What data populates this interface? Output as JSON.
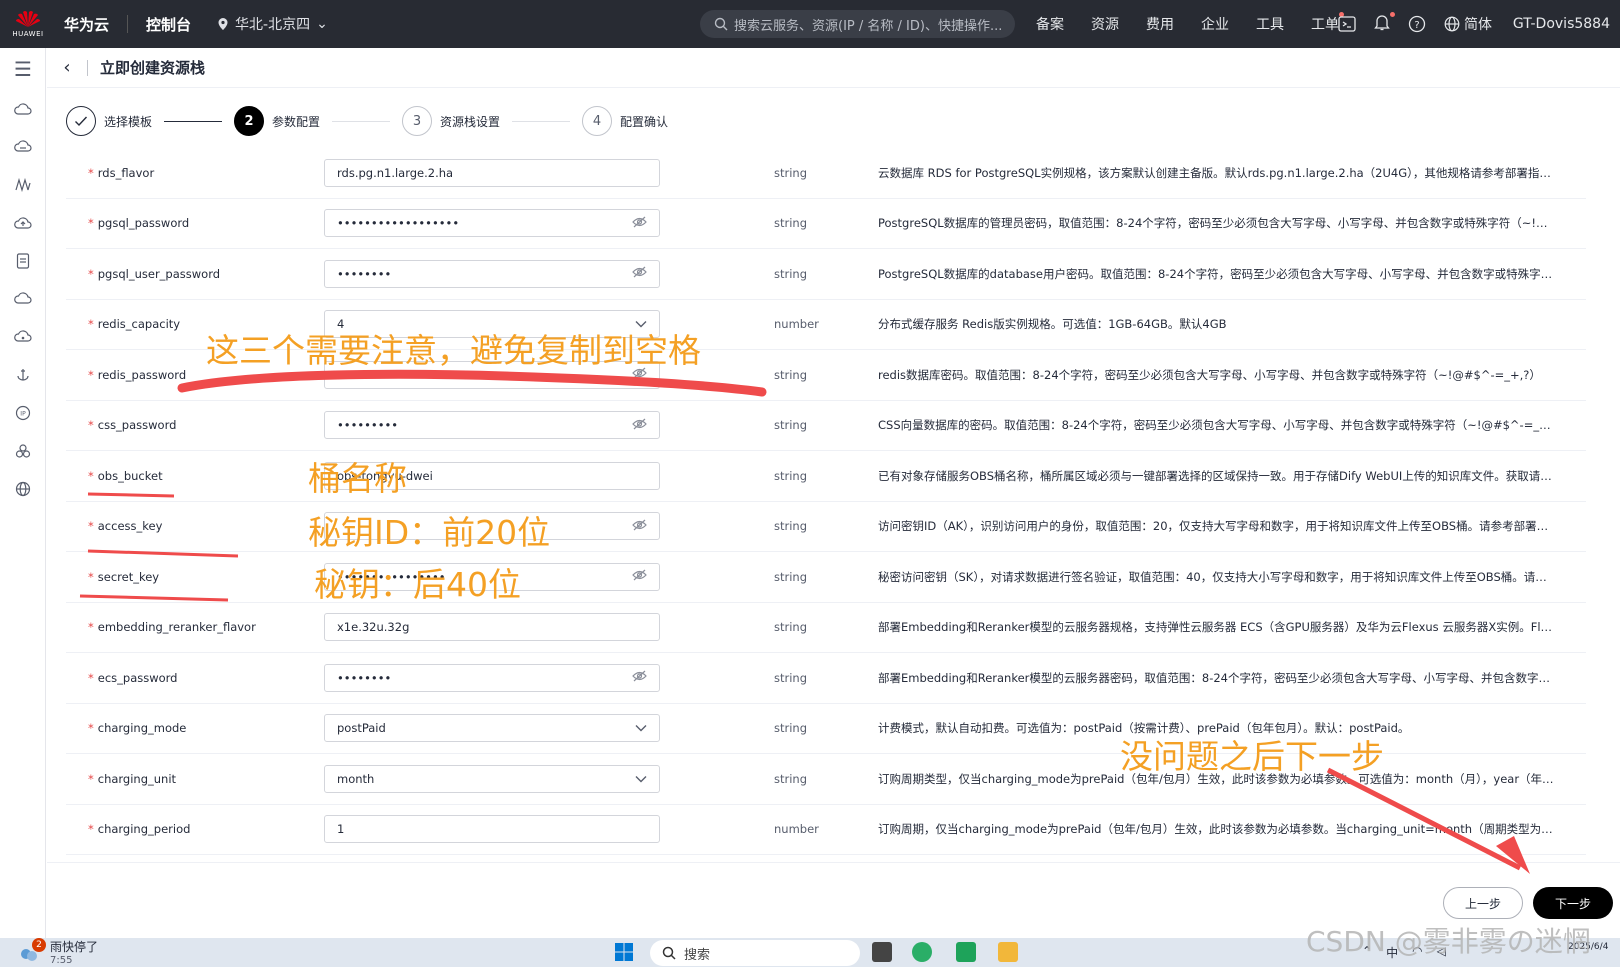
{
  "topbar": {
    "logo_text": "HUAWEI",
    "brand": "华为云",
    "console": "控制台",
    "region": "华北-北京四",
    "search_placeholder": "搜索云服务、资源(IP / 名称 / ID)、快捷操作...",
    "nav": [
      "备案",
      "资源",
      "费用",
      "企业",
      "工具",
      "工单"
    ],
    "language": "简体",
    "user": "GT-Dovis5884"
  },
  "page": {
    "title": "立即创建资源栈"
  },
  "steps": [
    {
      "index": "✓",
      "label": "选择模板",
      "state": "done"
    },
    {
      "index": "2",
      "label": "参数配置",
      "state": "active"
    },
    {
      "index": "3",
      "label": "资源栈设置",
      "state": "todo"
    },
    {
      "index": "4",
      "label": "配置确认",
      "state": "todo"
    }
  ],
  "params": [
    {
      "name": "rds_flavor",
      "value": "rds.pg.n1.large.2.ha",
      "control": "text",
      "type": "string",
      "desc": "云数据库 RDS for PostgreSQL实例规格，该方案默认创建主备版。默认rds.pg.n1.large.2.ha（2U4G），其他规格请参考部署指南配..."
    },
    {
      "name": "pgsql_password",
      "value": "••••••••••••••••••",
      "control": "password",
      "type": "string",
      "desc": "PostgreSQL数据库的管理员密码，取值范围：8-24个字符，密码至少必须包含大写字母、小写字母、并包含数字或特殊字符（~!@#$..."
    },
    {
      "name": "pgsql_user_password",
      "value": "••••••••",
      "control": "password",
      "type": "string",
      "desc": "PostgreSQL数据库的database用户密码。取值范围：8-24个字符，密码至少必须包含大写字母、小写字母、并包含数字或特殊字符（..."
    },
    {
      "name": "redis_capacity",
      "value": "4",
      "control": "select",
      "type": "number",
      "desc": "分布式缓存服务 Redis版实例规格。可选值：1GB-64GB。默认4GB"
    },
    {
      "name": "redis_password",
      "value": "",
      "control": "password",
      "type": "string",
      "desc": "redis数据库密码。取值范围：8-24个字符，密码至少必须包含大写字母、小写字母、并包含数字或特殊字符（~!@#$^-=_+,?）"
    },
    {
      "name": "css_password",
      "value": "•••••••••",
      "control": "password",
      "type": "string",
      "desc": "CSS向量数据库的密码。取值范围：8-24个字符，密码至少必须包含大写字母、小写字母、并包含数字或特殊字符（~!@#$^-=_+,?）"
    },
    {
      "name": "obs_bucket",
      "value": "obs-tongyu-dwei",
      "control": "text",
      "type": "string",
      "desc": "已有对象存储服务OBS桶名称，桶所属区域必须与一键部署选择的区域保持一致。用于存储Dify WebUI上传的知识库文件。获取请参..."
    },
    {
      "name": "access_key",
      "value": "",
      "control": "password",
      "type": "string",
      "desc": "访问密钥ID（AK），识别访问用户的身份，取值范围：20，仅支持大写字母和数字，用于将知识库文件上传至OBS桶。请参考部署指南..."
    },
    {
      "name": "secret_key",
      "value": "••••••••••••••••",
      "control": "password",
      "type": "string",
      "desc": "秘密访问密钥（SK），对请求数据进行签名验证，取值范围：40，仅支持大小写字母和数字，用于将知识库文件上传至OBS桶。请参考..."
    },
    {
      "name": "embedding_reranker_flavor",
      "value": "x1e.32u.32g",
      "control": "text",
      "type": "string",
      "desc": "部署Embedding和Reranker模型的云服务器规格，支持弹性云服务器 ECS（含GPU服务器）及华为云Flexus 云服务器X实例。Flexus..."
    },
    {
      "name": "ecs_password",
      "value": "••••••••",
      "control": "password",
      "type": "string",
      "desc": "部署Embedding和Reranker模型的云服务器密码，取值范围：8-24个字符，密码至少必须包含大写字母、小写字母、并包含数字或特..."
    },
    {
      "name": "charging_mode",
      "value": "postPaid",
      "control": "select",
      "type": "string",
      "desc": "计费模式，默认自动扣费。可选值为：postPaid（按需计费）、prePaid（包年包月）。默认：postPaid。"
    },
    {
      "name": "charging_unit",
      "value": "month",
      "control": "select",
      "type": "string",
      "desc": "订购周期类型，仅当charging_mode为prePaid（包年/包月）生效，此时该参数为必填参数。可选值为：month（月），year（年）。..."
    },
    {
      "name": "charging_period",
      "value": "1",
      "control": "text",
      "type": "number",
      "desc": "订购周期，仅当charging_mode为prePaid（包年/包月）生效，此时该参数为必填参数。当charging_unit=month（周期类型为月）时..."
    }
  ],
  "footer": {
    "prev_label": "上一步",
    "next_label": "下一步"
  },
  "annotations": {
    "note_redis": "这三个需要注意，避免复制到空格",
    "note_bucket": "桶名称",
    "note_ak": "秘钥ID：前20位",
    "note_sk": "秘钥：后40位",
    "note_next": "没问题之后下一步"
  },
  "watermark": "CSDN @雾非雾の迷惘",
  "taskbar": {
    "weather": "雨快停了",
    "weather_time": "7:55",
    "badge": "2",
    "search": "搜索",
    "tray_ime": "中",
    "clock": "2025/6/4"
  },
  "colors": {
    "topbar": "#282b33",
    "annotation": "#f4a024",
    "underline": "#ef4b4b",
    "primary_button": "#000000"
  }
}
